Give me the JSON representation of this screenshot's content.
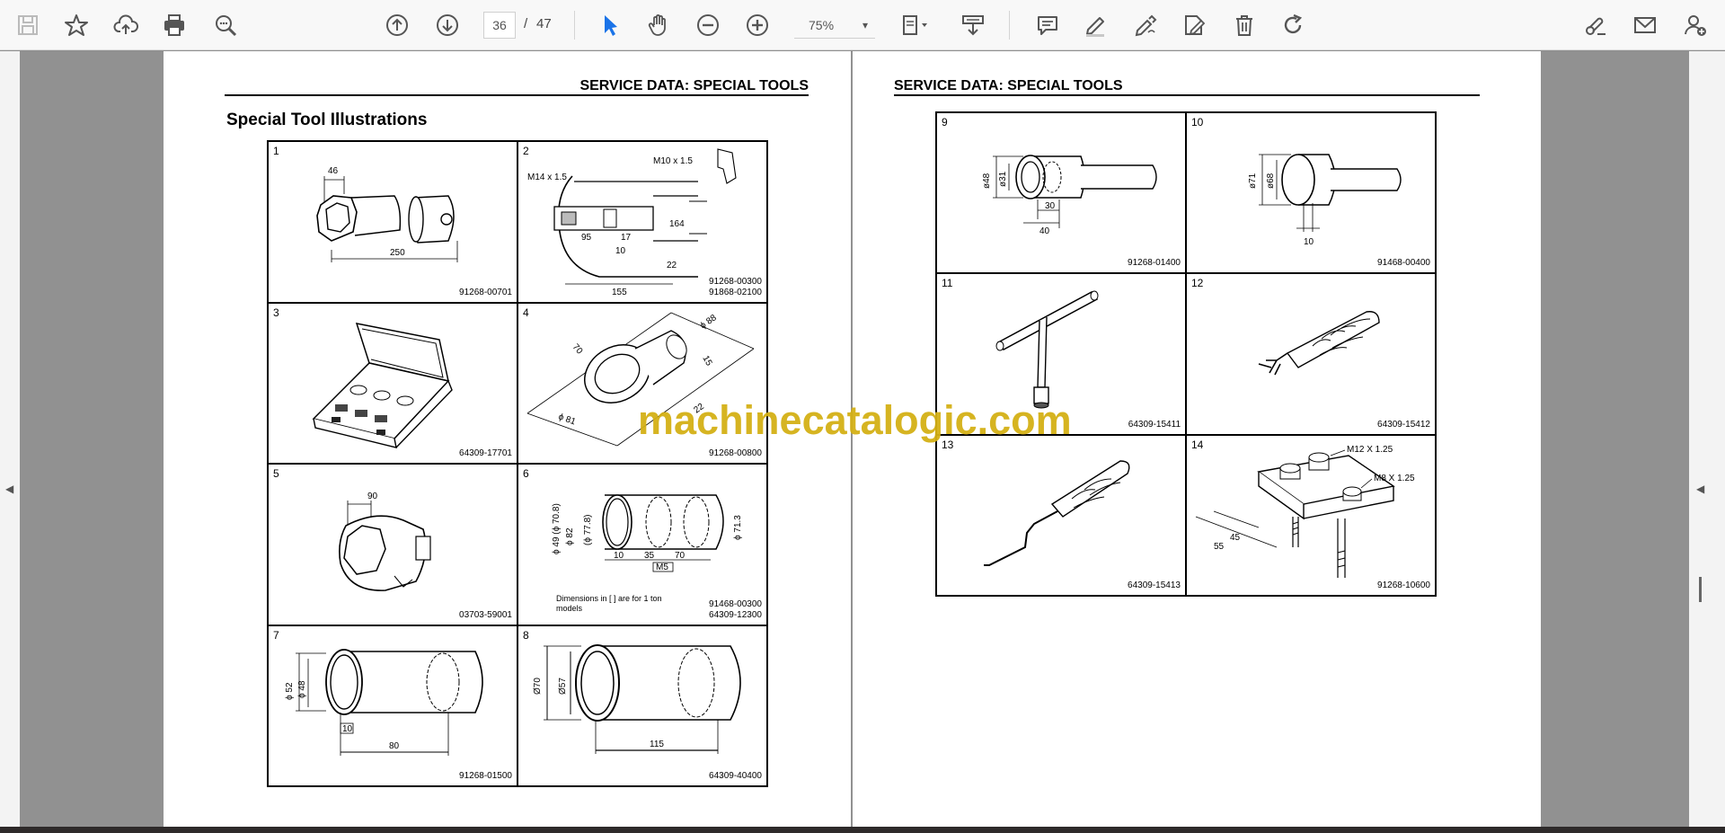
{
  "toolbar": {
    "current_page": "36",
    "page_separator": "/",
    "total_pages": "47",
    "zoom": "75%",
    "zoom_caret": "▾",
    "colors": {
      "accent": "#1a73e8",
      "icon": "#555555"
    }
  },
  "viewer": {
    "left_arrow": "◀",
    "right_arrow": "◀"
  },
  "left_page": {
    "header": "SERVICE DATA: SPECIAL TOOLS",
    "section_title": "Special Tool Illustrations",
    "cells": [
      {
        "num": "1",
        "code": "91268-00701",
        "dims": [
          "46",
          "250"
        ]
      },
      {
        "num": "2",
        "code": "91268-00300\n91868-02100",
        "dims": [
          "M10 x 1.5",
          "M14 x 1.5",
          "164",
          "95",
          "17",
          "10",
          "22",
          "155"
        ]
      },
      {
        "num": "3",
        "code": "64309-17701"
      },
      {
        "num": "4",
        "code": "91268-00800",
        "dims": [
          "70",
          "ϕ 88",
          "15",
          "22",
          "ϕ 81"
        ]
      },
      {
        "num": "5",
        "code": "03703-59001",
        "dims": [
          "90"
        ]
      },
      {
        "num": "6",
        "code": "91468-00300\n64309-12300",
        "note": "Dimensions in [ ] are for 1 ton models",
        "dims": [
          "ϕ 49 (ϕ 70.8)",
          "ϕ 82",
          "(ϕ 77.8)",
          "ϕ 71.3",
          "10",
          "35",
          "70",
          "M5"
        ]
      },
      {
        "num": "7",
        "code": "91268-01500",
        "dims": [
          "ϕ 52",
          "ϕ 48",
          "10",
          "80"
        ]
      },
      {
        "num": "8",
        "code": "64309-40400",
        "dims": [
          "Ø70",
          "Ø57",
          "115"
        ]
      }
    ]
  },
  "right_page": {
    "header": "SERVICE DATA: SPECIAL TOOLS",
    "cells": [
      {
        "num": "9",
        "code": "91268-01400",
        "dims": [
          "ø48",
          "ø31",
          "30",
          "40"
        ]
      },
      {
        "num": "10",
        "code": "91468-00400",
        "dims": [
          "ø71",
          "ø68",
          "10"
        ]
      },
      {
        "num": "11",
        "code": "64309-15411"
      },
      {
        "num": "12",
        "code": "64309-15412"
      },
      {
        "num": "13",
        "code": "64309-15413"
      },
      {
        "num": "14",
        "code": "91268-10600",
        "dims": [
          "M12 X 1.25",
          "M8 X 1.25",
          "45",
          "55"
        ]
      }
    ]
  },
  "watermark": "machinecatalogic.com"
}
